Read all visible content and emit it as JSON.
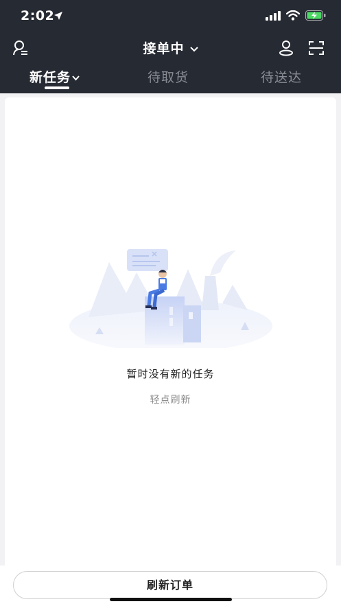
{
  "status_bar": {
    "time": "2:02"
  },
  "header": {
    "title": "接单中",
    "tabs": [
      {
        "label": "新任务"
      },
      {
        "label": "待取货"
      },
      {
        "label": "待送达"
      }
    ]
  },
  "empty_state": {
    "message": "暂时没有新的任务",
    "hint": "轻点刷新"
  },
  "bottom": {
    "refresh_button": "刷新订单"
  },
  "colors": {
    "header_bg": "#262a33",
    "accent": "#5b7fe0"
  }
}
